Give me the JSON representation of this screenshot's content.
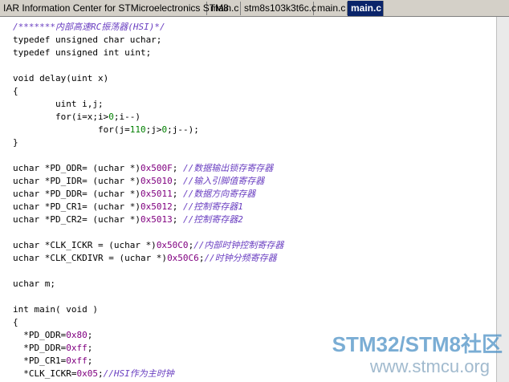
{
  "tabs": [
    {
      "label": "IAR Information Center for STMicroelectronics STM8",
      "active": false
    },
    {
      "label": "main.c",
      "active": false
    },
    {
      "label": "stm8s103k3t6c.c",
      "active": false
    },
    {
      "label": "main.c",
      "active": false
    },
    {
      "label": "main.c",
      "active": true
    }
  ],
  "code_lines": [
    [
      {
        "t": "/*******内部高速RC振荡器(HSI)*/",
        "c": "cm"
      }
    ],
    [
      {
        "t": "typedef unsigned char uchar;"
      }
    ],
    [
      {
        "t": "typedef unsigned int uint;"
      }
    ],
    [],
    [
      {
        "t": "void delay(uint x)"
      }
    ],
    [
      {
        "t": "{"
      }
    ],
    [
      {
        "t": "        uint i,j;"
      }
    ],
    [
      {
        "t": "        for(i=x;i>"
      },
      {
        "t": "0",
        "c": "nm"
      },
      {
        "t": ";i--)"
      }
    ],
    [
      {
        "t": "                for(j="
      },
      {
        "t": "110",
        "c": "nm"
      },
      {
        "t": ";j>"
      },
      {
        "t": "0",
        "c": "nm"
      },
      {
        "t": ";j--);"
      }
    ],
    [
      {
        "t": "}"
      }
    ],
    [],
    [
      {
        "t": "uchar *PD_ODR= (uchar *)"
      },
      {
        "t": "0x500F",
        "c": "hx"
      },
      {
        "t": "; "
      },
      {
        "t": "//数据输出锁存寄存器",
        "c": "cm"
      }
    ],
    [
      {
        "t": "uchar *PD_IDR= (uchar *)"
      },
      {
        "t": "0x5010",
        "c": "hx"
      },
      {
        "t": "; "
      },
      {
        "t": "//输入引脚值寄存器",
        "c": "cm"
      }
    ],
    [
      {
        "t": "uchar *PD_DDR= (uchar *)"
      },
      {
        "t": "0x5011",
        "c": "hx"
      },
      {
        "t": "; "
      },
      {
        "t": "//数据方向寄存器",
        "c": "cm"
      }
    ],
    [
      {
        "t": "uchar *PD_CR1= (uchar *)"
      },
      {
        "t": "0x5012",
        "c": "hx"
      },
      {
        "t": "; "
      },
      {
        "t": "//控制寄存器1",
        "c": "cm"
      }
    ],
    [
      {
        "t": "uchar *PD_CR2= (uchar *)"
      },
      {
        "t": "0x5013",
        "c": "hx"
      },
      {
        "t": "; "
      },
      {
        "t": "//控制寄存器2",
        "c": "cm"
      }
    ],
    [],
    [
      {
        "t": "uchar *CLK_ICKR = (uchar *)"
      },
      {
        "t": "0x50C0",
        "c": "hx"
      },
      {
        "t": ";"
      },
      {
        "t": "//内部时钟控制寄存器",
        "c": "cm"
      }
    ],
    [
      {
        "t": "uchar *CLK_CKDIVR = (uchar *)"
      },
      {
        "t": "0x50C6",
        "c": "hx"
      },
      {
        "t": ";"
      },
      {
        "t": "//时钟分频寄存器",
        "c": "cm"
      }
    ],
    [],
    [
      {
        "t": "uchar m;"
      }
    ],
    [],
    [
      {
        "t": "int main( void )"
      }
    ],
    [
      {
        "t": "{"
      }
    ],
    [
      {
        "t": "  *PD_ODR="
      },
      {
        "t": "0x80",
        "c": "hx"
      },
      {
        "t": ";"
      }
    ],
    [
      {
        "t": "  *PD_DDR="
      },
      {
        "t": "0xff",
        "c": "hx"
      },
      {
        "t": ";"
      }
    ],
    [
      {
        "t": "  *PD_CR1="
      },
      {
        "t": "0xff",
        "c": "hx"
      },
      {
        "t": ";"
      }
    ],
    [
      {
        "t": "  *CLK_ICKR="
      },
      {
        "t": "0x05",
        "c": "hx"
      },
      {
        "t": ";"
      },
      {
        "t": "//HSI作为主时钟",
        "c": "cm"
      }
    ]
  ],
  "watermark": {
    "line1": "STM32/STM8社区",
    "line2": "www.stmcu.org"
  }
}
